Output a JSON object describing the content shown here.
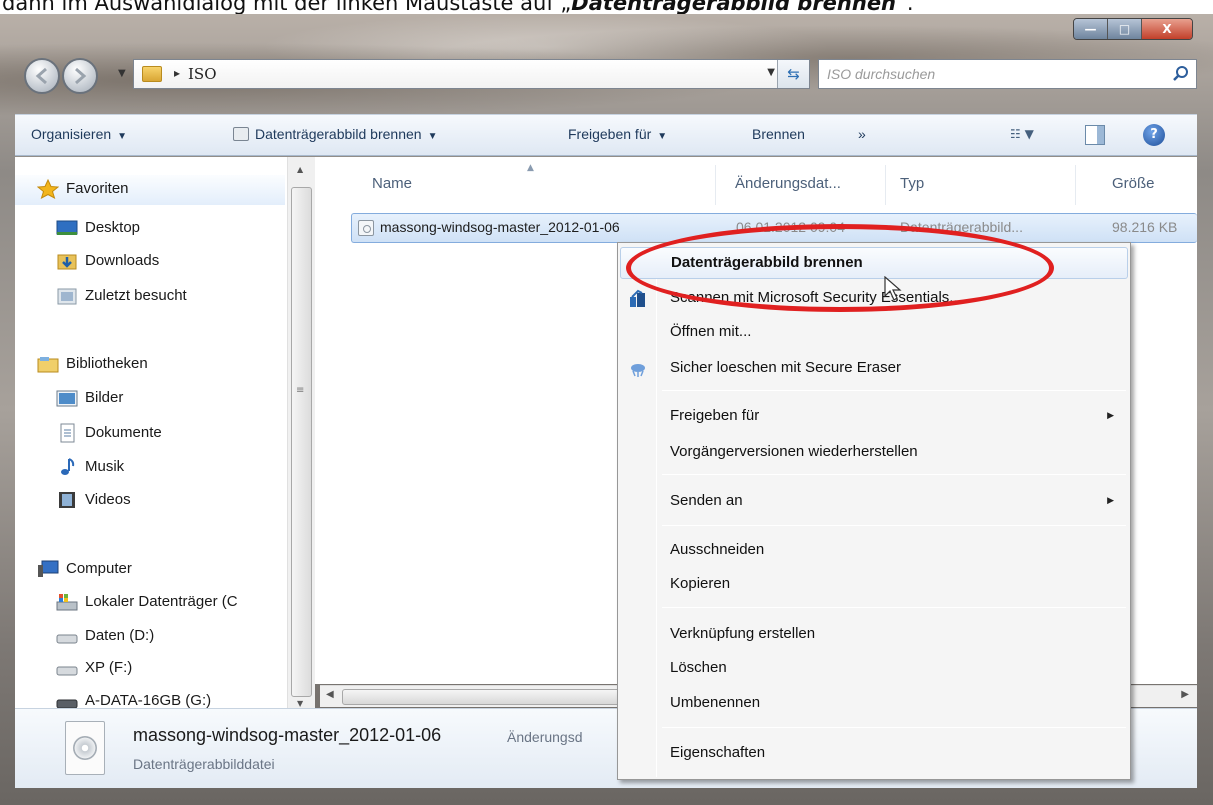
{
  "caption": {
    "prefix": "dann im Auswahldialog mit der linken Maustaste auf „",
    "bold": "Datenträgerabbild brennen",
    "suffix": "“."
  },
  "window": {
    "minimize_glyph": "—",
    "maximize_glyph": "□",
    "close_glyph": "X"
  },
  "address": {
    "separator": "▸",
    "path": "ISO"
  },
  "search": {
    "placeholder": "ISO durchsuchen"
  },
  "toolbar": {
    "organize": "Organisieren",
    "burn_image": "Datenträgerabbild brennen",
    "share_with": "Freigeben für",
    "burn": "Brennen",
    "more": "»",
    "help": "?"
  },
  "nav": {
    "favorites": "Favoriten",
    "desktop": "Desktop",
    "downloads": "Downloads",
    "recent": "Zuletzt besucht",
    "libraries": "Bibliotheken",
    "pictures": "Bilder",
    "documents": "Dokumente",
    "music": "Musik",
    "videos": "Videos",
    "computer": "Computer",
    "local_disk": "Lokaler Datenträger (C",
    "data_d": "Daten (D:)",
    "xp_f": "XP (F:)",
    "adata_g": "A-DATA-16GB (G:)"
  },
  "columns": {
    "name": "Name",
    "modified": "Änderungsdat...",
    "type": "Typ",
    "size": "Größe"
  },
  "file": {
    "name": "massong-windsog-master_2012-01-06",
    "modified": "06.01.2012 09:04",
    "type": "Datenträgerabbild...",
    "size": "98.216 KB"
  },
  "details": {
    "name": "massong-windsog-master_2012-01-06",
    "meta": "Änderungsd",
    "type": "Datenträgerabbilddatei"
  },
  "context_menu": {
    "burn": "Datenträgerabbild brennen",
    "scan": "Scannen mit Microsoft Security Essentials...",
    "open_with": "Öffnen mit...",
    "secure_erase": "Sicher loeschen mit Secure Eraser",
    "share_with": "Freigeben für",
    "restore": "Vorgängerversionen wiederherstellen",
    "send_to": "Senden an",
    "cut": "Ausschneiden",
    "copy": "Kopieren",
    "shortcut": "Verknüpfung erstellen",
    "delete": "Löschen",
    "rename": "Umbenennen",
    "properties": "Eigenschaften",
    "submenu_arrow": "▶"
  },
  "colors": {
    "highlight_ellipse": "#e02020",
    "toolbar_text": "#1e395b",
    "selection": "#cfe1f6"
  }
}
